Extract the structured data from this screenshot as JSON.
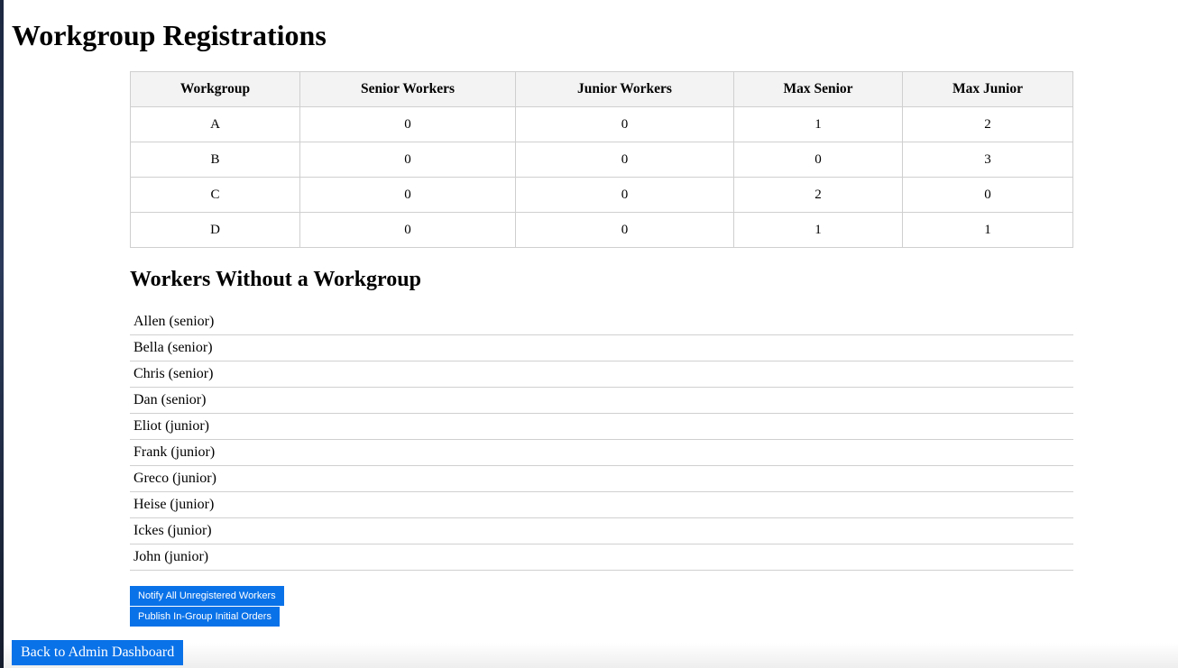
{
  "page": {
    "title": "Workgroup Registrations"
  },
  "groups_table": {
    "headers": [
      "Workgroup",
      "Senior Workers",
      "Junior Workers",
      "Max Senior",
      "Max Junior"
    ],
    "rows": [
      [
        "A",
        "0",
        "0",
        "1",
        "2"
      ],
      [
        "B",
        "0",
        "0",
        "0",
        "3"
      ],
      [
        "C",
        "0",
        "0",
        "2",
        "0"
      ],
      [
        "D",
        "0",
        "0",
        "1",
        "1"
      ]
    ]
  },
  "unassigned": {
    "title": "Workers Without a Workgroup",
    "workers": [
      "Allen (senior)",
      "Bella (senior)",
      "Chris (senior)",
      "Dan (senior)",
      "Eliot (junior)",
      "Frank (junior)",
      "Greco (junior)",
      "Heise (junior)",
      "Ickes (junior)",
      "John (junior)"
    ]
  },
  "actions": {
    "notify_label": "Notify All Unregistered Workers",
    "publish_label": "Publish In-Group Initial Orders",
    "back_label": "Back to Admin Dashboard"
  },
  "colors": {
    "button": "#0a72e8",
    "header_bg": "#f3f3f3",
    "border": "#cfcfcf"
  }
}
